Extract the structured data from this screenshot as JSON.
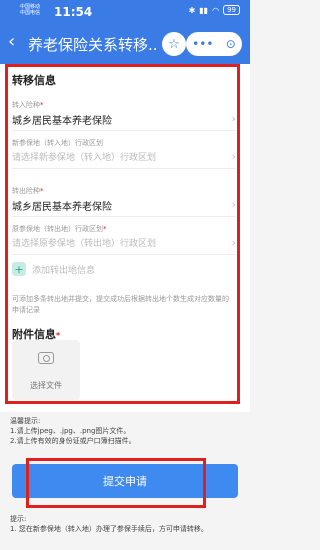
{
  "status_bar": {
    "carrier_line1": "中国移动",
    "carrier_line2": "中国电信",
    "time": "11:54",
    "battery": "99"
  },
  "nav": {
    "title": "养老保险关系转移...",
    "back_icon": "back-icon"
  },
  "transfer_section": {
    "title": "转移信息",
    "in_type_label": "转入险种",
    "in_type_value": "城乡居民基本养老保险",
    "new_area_label": "新参保地（转入地）行政区划",
    "new_area_placeholder": "请选择新参保地（转入地）行政区划",
    "out_type_label": "转出险种",
    "out_type_value": "城乡居民基本养老保险",
    "old_area_label": "原参保地（转出地）行政区划",
    "old_area_placeholder": "请选择原参保地（转出地）行政区划",
    "add_label": "添加转出地信息",
    "note": "可添加多条转出地并提交，提交成功后根据转出地个数生成对应数量的申请记录"
  },
  "attachments": {
    "title": "附件信息",
    "required_mark": "*",
    "upload_label": "选择文件"
  },
  "tips": {
    "title": "温馨提示:",
    "line1": "1.请上传jpeg、.jpg、.png图片文件。",
    "line2": "2.请上传有效的身份证或户口簿扫描件。"
  },
  "submit": {
    "label": "提交申请"
  },
  "tips2": {
    "title": "提示:",
    "line1": "1. 您在新参保地（转入地）办理了参保手续后，方可申请转移。"
  }
}
